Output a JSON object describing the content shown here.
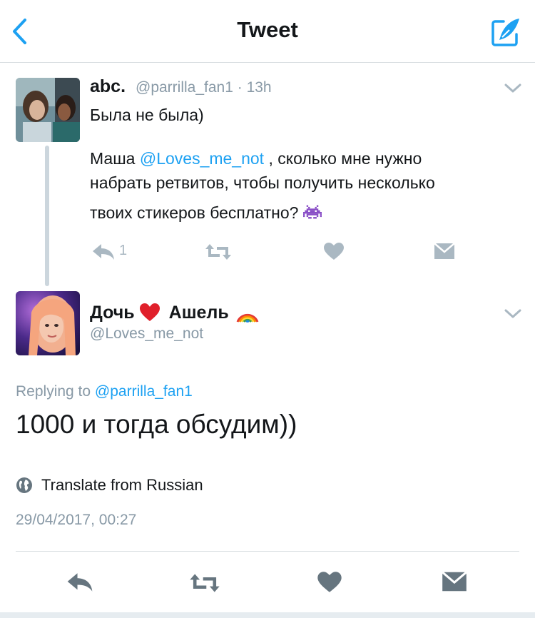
{
  "header": {
    "title": "Tweet",
    "back_icon": "chevron-left-icon",
    "compose_icon": "compose-tweet-icon",
    "accent_color": "#1da1f2"
  },
  "parent_tweet": {
    "name": "abc.",
    "handle": "@parrilla_fan1",
    "separator": "·",
    "time": "13h",
    "lines": [
      "Была не была)",
      "",
      "Маша ",
      "@Loves_me_not",
      " , сколько мне нужно",
      "набрать ретвитов, чтобы получить несколько",
      "твоих стикеров бесплатно? "
    ],
    "emoji_icon": "alien-monster-emoji",
    "reply_count": "1"
  },
  "reply_tweet": {
    "name_part1": "Дочь",
    "name_part2": "Ашель",
    "heart_icon": "red-heart-emoji",
    "rainbow_icon": "rainbow-emoji",
    "handle": "@Loves_me_not",
    "replying_prefix": "Replying to ",
    "replying_mention": "@parrilla_fan1",
    "text": "1000 и тогда обсудим))",
    "translate_label": "Translate from Russian",
    "timestamp": "29/04/2017, 00:27"
  },
  "colors": {
    "text": "#14171a",
    "muted": "#8899a6",
    "icon_gray": "#aab8c2",
    "mention": "#1da1f2",
    "divider": "#d8dde1"
  }
}
